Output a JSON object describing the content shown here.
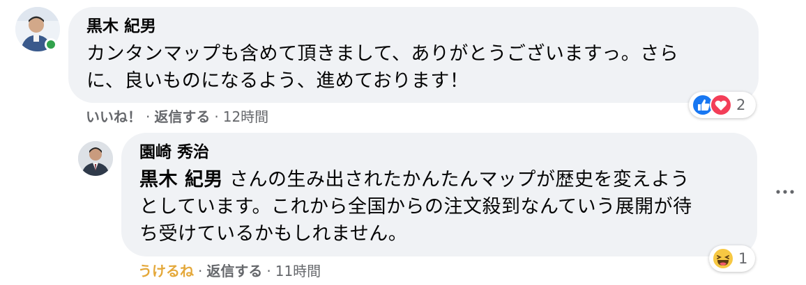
{
  "comment": {
    "author": "黒木 紀男",
    "text_lines": [
      "カンタンマップも含めて頂きまして、ありがとうございますっ。さら",
      "に、良いものになるよう、進めております！"
    ],
    "actions": {
      "like": "いいね！",
      "reply": "返信する",
      "time": "12時間"
    },
    "reactions": {
      "icons": [
        "like-icon",
        "love-icon"
      ],
      "count": "2"
    },
    "avatar_online": true
  },
  "reply": {
    "author": "園崎 秀治",
    "mention": "黒木 紀男",
    "text_line1_rest": " さんの生み出されたかんたんマップが歴史を変えよう",
    "text_lines_more": [
      "としています。これから全国からの注文殺到なんていう展開が待",
      "ち受けているかもしれません。"
    ],
    "actions": {
      "like": "うけるね",
      "reply": "返信する",
      "time": "11時間"
    },
    "reactions": {
      "icons": [
        "haha-icon"
      ],
      "count": "1"
    }
  },
  "colors": {
    "bubble": "#f0f2f5",
    "secondary_text": "#65676b",
    "haha_reaction": "#e4a83a",
    "online": "#31a24c",
    "like_blue": "#1877f2",
    "love_red": "#f33e58"
  }
}
